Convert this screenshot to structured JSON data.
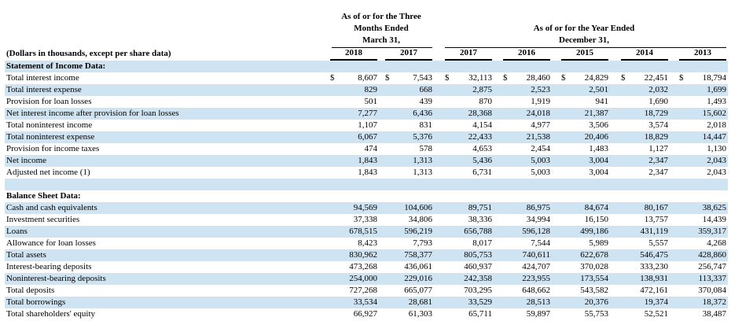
{
  "header": {
    "units_label": "(Dollars in thousands, except per share data)",
    "group1_lines": [
      "As of or for the Three",
      "Months Ended",
      "March 31,"
    ],
    "group2_lines": [
      "As of or for the Year Ended",
      "December 31,"
    ],
    "years": [
      "2018",
      "2017",
      "2017",
      "2016",
      "2015",
      "2014",
      "2013"
    ]
  },
  "income_section": {
    "title": "Statement of Income Data:",
    "rows": [
      {
        "label": "Total interest income",
        "dollar": true,
        "values": [
          "8,607",
          "7,543",
          "32,113",
          "28,460",
          "24,829",
          "22,451",
          "18,794"
        ]
      },
      {
        "label": "Total interest expense",
        "values": [
          "829",
          "668",
          "2,875",
          "2,523",
          "2,501",
          "2,032",
          "1,699"
        ]
      },
      {
        "label": "Provision for loan losses",
        "values": [
          "501",
          "439",
          "870",
          "1,919",
          "941",
          "1,690",
          "1,493"
        ]
      },
      {
        "label": "Net interest income after provision for loan losses",
        "values": [
          "7,277",
          "6,436",
          "28,368",
          "24,018",
          "21,387",
          "18,729",
          "15,602"
        ]
      },
      {
        "label": "Total noninterest income",
        "values": [
          "1,107",
          "831",
          "4,154",
          "4,977",
          "3,506",
          "3,574",
          "2,018"
        ]
      },
      {
        "label": "Total noninterest expense",
        "values": [
          "6,067",
          "5,376",
          "22,433",
          "21,538",
          "20,406",
          "18,829",
          "14,447"
        ]
      },
      {
        "label": "Provision for income taxes",
        "values": [
          "474",
          "578",
          "4,653",
          "2,454",
          "1,483",
          "1,127",
          "1,130"
        ]
      },
      {
        "label": "Net income",
        "values": [
          "1,843",
          "1,313",
          "5,436",
          "5,003",
          "3,004",
          "2,347",
          "2,043"
        ]
      },
      {
        "label": "Adjusted net income (1)",
        "values": [
          "1,843",
          "1,313",
          "6,731",
          "5,003",
          "3,004",
          "2,347",
          "2,043"
        ]
      }
    ]
  },
  "balance_section": {
    "title": "Balance Sheet Data:",
    "rows": [
      {
        "label": "Cash and cash equivalents",
        "values": [
          "94,569",
          "104,606",
          "89,751",
          "86,975",
          "84,674",
          "80,167",
          "38,625"
        ]
      },
      {
        "label": "Investment securities",
        "values": [
          "37,338",
          "34,806",
          "38,336",
          "34,994",
          "16,150",
          "13,757",
          "14,439"
        ]
      },
      {
        "label": "Loans",
        "values": [
          "678,515",
          "596,219",
          "656,788",
          "596,128",
          "499,186",
          "431,119",
          "359,317"
        ]
      },
      {
        "label": "Allowance for loan losses",
        "values": [
          "8,423",
          "7,793",
          "8,017",
          "7,544",
          "5,989",
          "5,557",
          "4,268"
        ]
      },
      {
        "label": "Total assets",
        "values": [
          "830,962",
          "758,377",
          "805,753",
          "740,611",
          "622,678",
          "546,475",
          "428,860"
        ]
      },
      {
        "label": "Interest-bearing deposits",
        "values": [
          "473,268",
          "436,061",
          "460,937",
          "424,707",
          "370,028",
          "333,230",
          "256,747"
        ]
      },
      {
        "label": "Noninterest-bearing deposits",
        "values": [
          "254,000",
          "229,016",
          "242,358",
          "223,955",
          "173,554",
          "138,931",
          "113,337"
        ]
      },
      {
        "label": "Total deposits",
        "values": [
          "727,268",
          "665,077",
          "703,295",
          "648,662",
          "543,582",
          "472,161",
          "370,084"
        ]
      },
      {
        "label": "Total borrowings",
        "values": [
          "33,534",
          "28,681",
          "33,529",
          "28,513",
          "20,376",
          "19,374",
          "18,372"
        ]
      },
      {
        "label": "Total shareholders' equity",
        "values": [
          "66,927",
          "61,303",
          "65,711",
          "59,897",
          "55,753",
          "52,521",
          "38,487"
        ]
      }
    ]
  }
}
